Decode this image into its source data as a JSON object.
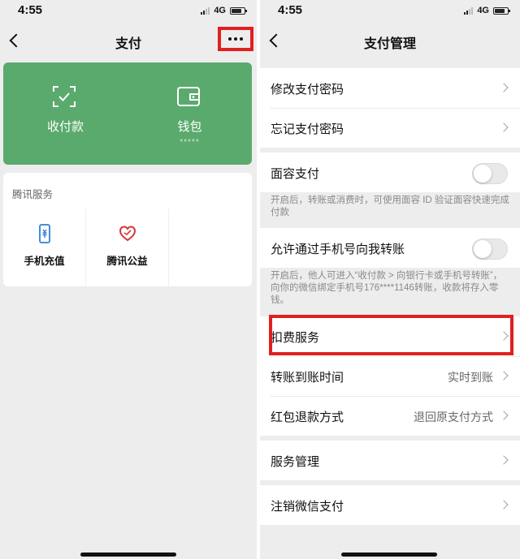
{
  "left": {
    "status": {
      "time": "4:55",
      "network": "4G"
    },
    "nav": {
      "title": "支付"
    },
    "wallet": {
      "receive_label": "收付款",
      "wallet_label": "钱包",
      "wallet_mask": "*****"
    },
    "services": {
      "title": "腾讯服务",
      "items": [
        {
          "label": "手机充值",
          "icon": "phone-recharge-icon"
        },
        {
          "label": "腾讯公益",
          "icon": "charity-heart-icon"
        }
      ]
    }
  },
  "right": {
    "status": {
      "time": "4:55",
      "network": "4G"
    },
    "nav": {
      "title": "支付管理"
    },
    "rows": {
      "change_password": "修改支付密码",
      "forgot_password": "忘记支付密码",
      "face_pay": "面容支付",
      "face_pay_note": "开启后，转账或消费时，可使用面容 ID 验证面容快速完成付款",
      "phone_transfer": "允许通过手机号向我转账",
      "phone_transfer_note": "开启后，他人可进入“收付款 > 向银行卡或手机号转账”，向你的微信绑定手机号176****1146转账，收款将存入零钱。",
      "deduction_services": "扣费服务",
      "transfer_time": "转账到账时间",
      "transfer_time_value": "实时到账",
      "red_packet_refund": "红包退款方式",
      "red_packet_refund_value": "退回原支付方式",
      "service_management": "服务管理",
      "cancel_wechat_pay": "注销微信支付"
    },
    "toggles": {
      "face_pay_on": false,
      "phone_transfer_on": false
    }
  },
  "colors": {
    "wallet_card": "#5aaa6e",
    "highlight": "#e02020",
    "background": "#ededed"
  }
}
